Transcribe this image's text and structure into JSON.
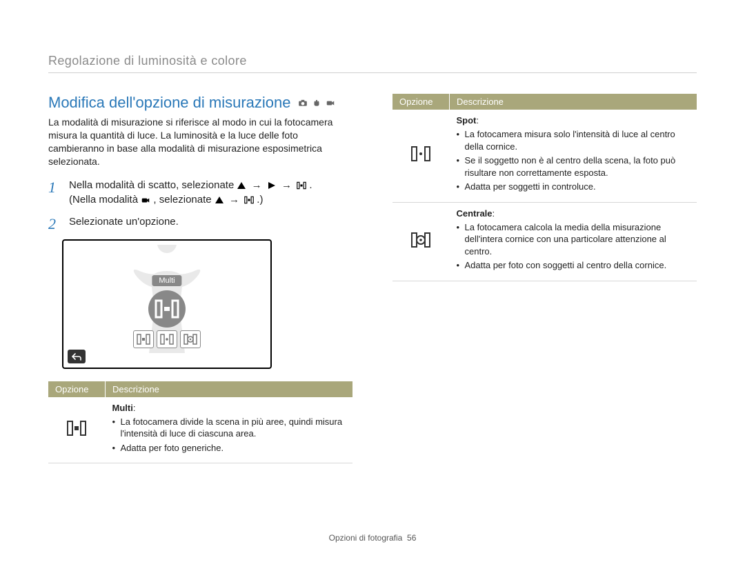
{
  "section_header": "Regolazione di luminosità e colore",
  "title": "Modifica dell'opzione di misurazione",
  "intro": "La modalità di misurazione si riferisce al modo in cui la fotocamera misura la quantità di luce. La luminosità e la luce delle foto cambieranno in base alla modalità di misurazione esposimetrica selezionata.",
  "step1": {
    "prefix": "Nella modalità di scatto, selezionate ",
    "suffix": ".",
    "alt_prefix": "(Nella modalità ",
    "alt_mid": ", selezionate ",
    "alt_suffix": ".)"
  },
  "arrow": "→",
  "step2": "Selezionate un'opzione.",
  "screenshot_label": "Multi",
  "table_header": {
    "option": "Opzione",
    "description": "Descrizione"
  },
  "left_options": [
    {
      "name": "Multi",
      "colon": ":",
      "bullets": [
        "La fotocamera divide la scena in più aree, quindi misura l'intensità di luce di ciascuna area.",
        "Adatta per foto generiche."
      ]
    }
  ],
  "right_options": [
    {
      "name": "Spot",
      "colon": ":",
      "bullets": [
        "La fotocamera misura solo l'intensità di luce al centro della cornice.",
        "Se il soggetto non è al centro della scena, la foto può risultare non correttamente esposta.",
        "Adatta per soggetti in controluce."
      ]
    },
    {
      "name": "Centrale",
      "colon": ":",
      "bullets": [
        "La fotocamera calcola la media della misurazione dell'intera cornice con una particolare attenzione al centro.",
        "Adatta per foto con soggetti al centro della cornice."
      ]
    }
  ],
  "footer": {
    "label": "Opzioni di fotografia",
    "page": "56"
  }
}
